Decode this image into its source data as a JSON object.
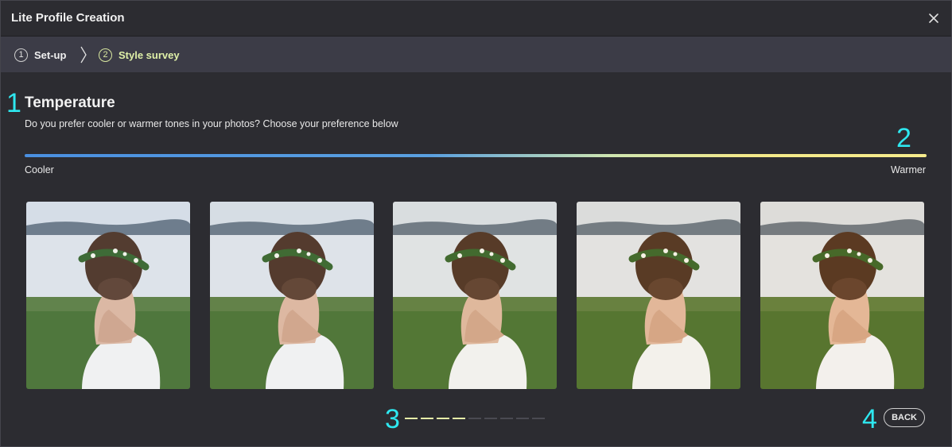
{
  "window": {
    "title": "Lite Profile Creation",
    "close_icon": "close-icon"
  },
  "steps": [
    {
      "number": "1",
      "label": "Set-up",
      "active": false
    },
    {
      "number": "2",
      "label": "Style survey",
      "active": true
    }
  ],
  "annotations": [
    "1",
    "2",
    "3",
    "4"
  ],
  "survey": {
    "heading": "Temperature",
    "question": "Do you prefer cooler or warmer tones in your photos? Choose your preference below",
    "slider_left_label": "Cooler",
    "slider_right_label": "Warmer"
  },
  "photos": [
    {
      "tint": "#8fa6c8"
    },
    {
      "tint": "#a6b2c4"
    },
    {
      "tint": "#c2bcb0"
    },
    {
      "tint": "#d0b898"
    },
    {
      "tint": "#dcb488"
    }
  ],
  "progress": {
    "total": 9,
    "completed": 4
  },
  "back_label": "BACK",
  "colors": {
    "accent": "#dff0a8",
    "annotation": "#2ee8f0"
  }
}
